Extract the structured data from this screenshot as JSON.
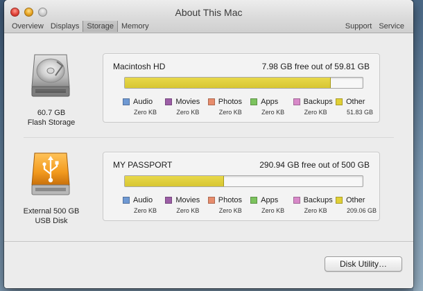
{
  "window": {
    "title": "About This Mac"
  },
  "tabs": {
    "left": [
      {
        "label": "Overview"
      },
      {
        "label": "Displays"
      },
      {
        "label": "Storage"
      },
      {
        "label": "Memory"
      }
    ],
    "active": "Storage",
    "right": [
      {
        "label": "Support"
      },
      {
        "label": "Service"
      }
    ]
  },
  "colors": {
    "audio": "#6f99d3",
    "movies": "#9c5ea6",
    "photos": "#e78c6c",
    "apps": "#7cc35e",
    "backups": "#d889c9",
    "other": "#e1d036",
    "accent_bar": "#dccb3b"
  },
  "drives": [
    {
      "icon": "internal-drive-icon",
      "caption_line1": "60.7 GB",
      "caption_line2": "Flash Storage",
      "name": "Macintosh HD",
      "free_text": "7.98 GB free out of 59.81 GB",
      "used_fraction": 0.8666,
      "legend": [
        {
          "key": "audio",
          "label": "Audio",
          "size": "Zero KB"
        },
        {
          "key": "movies",
          "label": "Movies",
          "size": "Zero KB"
        },
        {
          "key": "photos",
          "label": "Photos",
          "size": "Zero KB"
        },
        {
          "key": "apps",
          "label": "Apps",
          "size": "Zero KB"
        },
        {
          "key": "backups",
          "label": "Backups",
          "size": "Zero KB"
        },
        {
          "key": "other",
          "label": "Other",
          "size": "51.83 GB"
        }
      ]
    },
    {
      "icon": "external-usb-drive-icon",
      "caption_line1": "External 500 GB",
      "caption_line2": "USB Disk",
      "name": "MY PASSPORT",
      "free_text": "290.94 GB free out of 500 GB",
      "used_fraction": 0.4181,
      "legend": [
        {
          "key": "audio",
          "label": "Audio",
          "size": "Zero KB"
        },
        {
          "key": "movies",
          "label": "Movies",
          "size": "Zero KB"
        },
        {
          "key": "photos",
          "label": "Photos",
          "size": "Zero KB"
        },
        {
          "key": "apps",
          "label": "Apps",
          "size": "Zero KB"
        },
        {
          "key": "backups",
          "label": "Backups",
          "size": "Zero KB"
        },
        {
          "key": "other",
          "label": "Other",
          "size": "209.06 GB"
        }
      ]
    }
  ],
  "footer": {
    "disk_utility_label": "Disk Utility…"
  }
}
